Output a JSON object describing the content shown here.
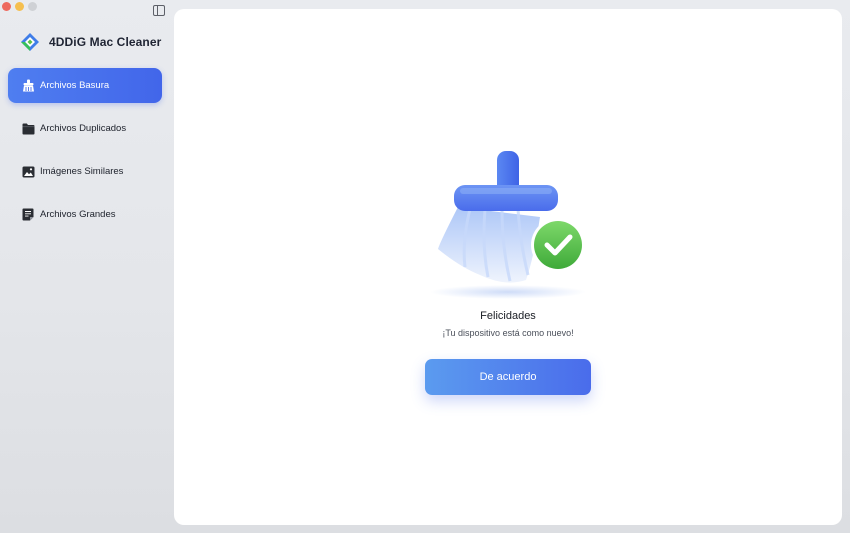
{
  "window": {
    "controls": [
      "close",
      "minimize",
      "zoom"
    ]
  },
  "app": {
    "name": "4DDiG Mac Cleaner",
    "logo_icon": "4ddig-logo-icon"
  },
  "sidebar": {
    "toggle_icon": "sidebar-toggle-icon",
    "items": [
      {
        "label": "Archivos Basura",
        "icon": "broom-icon",
        "active": true
      },
      {
        "label": "Archivos Duplicados",
        "icon": "folder-icon",
        "active": false
      },
      {
        "label": "Imágenes Similares",
        "icon": "image-icon",
        "active": false
      },
      {
        "label": "Archivos Grandes",
        "icon": "file-icon",
        "active": false
      }
    ]
  },
  "result": {
    "illustration": "broom-check-illustration",
    "title": "Felicidades",
    "message": "¡Tu dispositivo está como nuevo!",
    "button_label": "De acuerdo"
  },
  "colors": {
    "accent": "#4a6ceb",
    "success": "#5cc14a"
  }
}
